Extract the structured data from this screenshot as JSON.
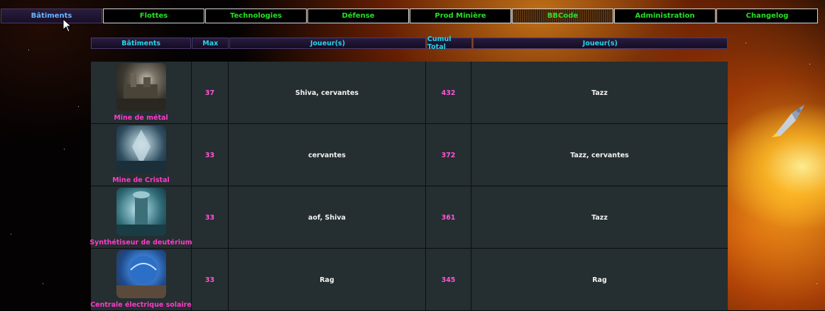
{
  "nav": {
    "tabs": [
      {
        "label": "Bâtiments",
        "style": "active"
      },
      {
        "label": "Flottes",
        "style": "normal"
      },
      {
        "label": "Technologies",
        "style": "normal"
      },
      {
        "label": "Défense",
        "style": "normal"
      },
      {
        "label": "Prod Minière",
        "style": "normal"
      },
      {
        "label": "BBCode",
        "style": "pattern"
      },
      {
        "label": "Administration",
        "style": "normal"
      },
      {
        "label": "Changelog",
        "style": "normal"
      }
    ]
  },
  "table": {
    "headers": [
      "Bâtiments",
      "Max",
      "Joueur(s)",
      "Cumul Total",
      "Joueur(s)"
    ],
    "rows": [
      {
        "building": "Mine de métal",
        "icon": "metal-mine-icon",
        "max": "37",
        "players_max": "Shiva, cervantes",
        "cumul": "432",
        "players_cumul": "Tazz"
      },
      {
        "building": "Mine de Cristal",
        "icon": "crystal-mine-icon",
        "max": "33",
        "players_max": "cervantes",
        "cumul": "372",
        "players_cumul": "Tazz, cervantes"
      },
      {
        "building": "Synthétiseur de deutérium",
        "icon": "deuterium-synthesizer-icon",
        "max": "33",
        "players_max": "aof, Shiva",
        "cumul": "361",
        "players_cumul": "Tazz"
      },
      {
        "building": "Centrale électrique solaire",
        "icon": "solar-plant-icon",
        "max": "33",
        "players_max": "Rag",
        "cumul": "345",
        "players_cumul": "Rag"
      }
    ]
  },
  "colors": {
    "nav_text": "#24e024",
    "nav_active_text": "#6ab4ff",
    "header_text": "#28d4e8",
    "number_text": "#ff55d4",
    "building_name": "#ff3acb",
    "row_bg": "#252e30"
  }
}
